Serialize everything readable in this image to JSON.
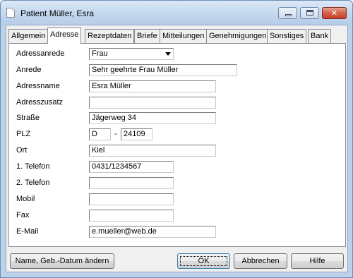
{
  "window": {
    "title": "Patient Müller, Esra"
  },
  "tabs": [
    {
      "label": "Allgemein"
    },
    {
      "label": "Adresse",
      "active": true
    },
    {
      "label": "Rezeptdaten"
    },
    {
      "label": "Briefe"
    },
    {
      "label": "Mitteilungen"
    },
    {
      "label": "Genehmigungen"
    },
    {
      "label": "Sonstiges"
    },
    {
      "label": "Bank"
    }
  ],
  "form": {
    "adressanrede": {
      "label": "Adressanrede",
      "value": "Frau"
    },
    "anrede": {
      "label": "Anrede",
      "value": "Sehr geehrte Frau Müller"
    },
    "adressname": {
      "label": "Adressname",
      "value": "Esra Müller"
    },
    "adresszusatz": {
      "label": "Adresszusatz",
      "value": ""
    },
    "strasse": {
      "label": "Straße",
      "value": "Jägerweg 34"
    },
    "plz": {
      "label": "PLZ",
      "country": "D",
      "separator": "-",
      "value": "24109"
    },
    "ort": {
      "label": "Ort",
      "value": "Kiel"
    },
    "telefon1": {
      "label": "1. Telefon",
      "value": "0431/1234567"
    },
    "telefon2": {
      "label": "2. Telefon",
      "value": ""
    },
    "mobil": {
      "label": "Mobil",
      "value": ""
    },
    "fax": {
      "label": "Fax",
      "value": ""
    },
    "email": {
      "label": "E-Mail",
      "value": "e.mueller@web.de"
    }
  },
  "buttons": {
    "name_change": "Name, Geb.-Datum ändern",
    "ok": "OK",
    "cancel": "Abbrechen",
    "help": "Hilfe"
  },
  "icons": {
    "window": "document-icon",
    "minimize": "minimize-icon",
    "maximize": "maximize-icon",
    "close": "close-icon",
    "dropdown": "chevron-down-icon"
  },
  "colors": {
    "title_bar": "#c2d6ee",
    "close_button": "#c7422a",
    "dialog_bg": "#f0f0f0",
    "panel_bg": "#ffffff"
  }
}
